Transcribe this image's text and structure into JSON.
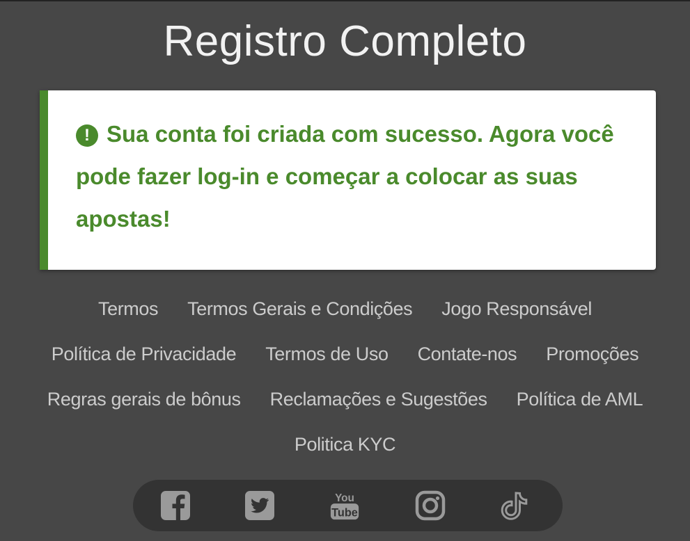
{
  "page": {
    "title": "Registro Completo"
  },
  "alert": {
    "icon": "exclamation-circle-icon",
    "message": "Sua conta foi criada com sucesso. Agora você pode fazer log-in e começar a colocar as suas apostas!",
    "color": "#4a8a2c"
  },
  "footer": {
    "links_row1": [
      "Termos",
      "Termos Gerais e Condições",
      "Jogo Responsável"
    ],
    "links_row2": [
      "Política de Privacidade",
      "Termos de Uso",
      "Contate-nos",
      "Promoções"
    ],
    "links_row3": [
      "Regras gerais de bônus",
      "Reclamações e Sugestões",
      "Política de AML"
    ],
    "links_row4": [
      "Politica KYC"
    ]
  },
  "social": {
    "icons": [
      "facebook-icon",
      "twitter-icon",
      "youtube-icon",
      "instagram-icon",
      "tiktok-icon"
    ],
    "youtube_text_top": "You",
    "youtube_text_bottom": "Tube"
  }
}
